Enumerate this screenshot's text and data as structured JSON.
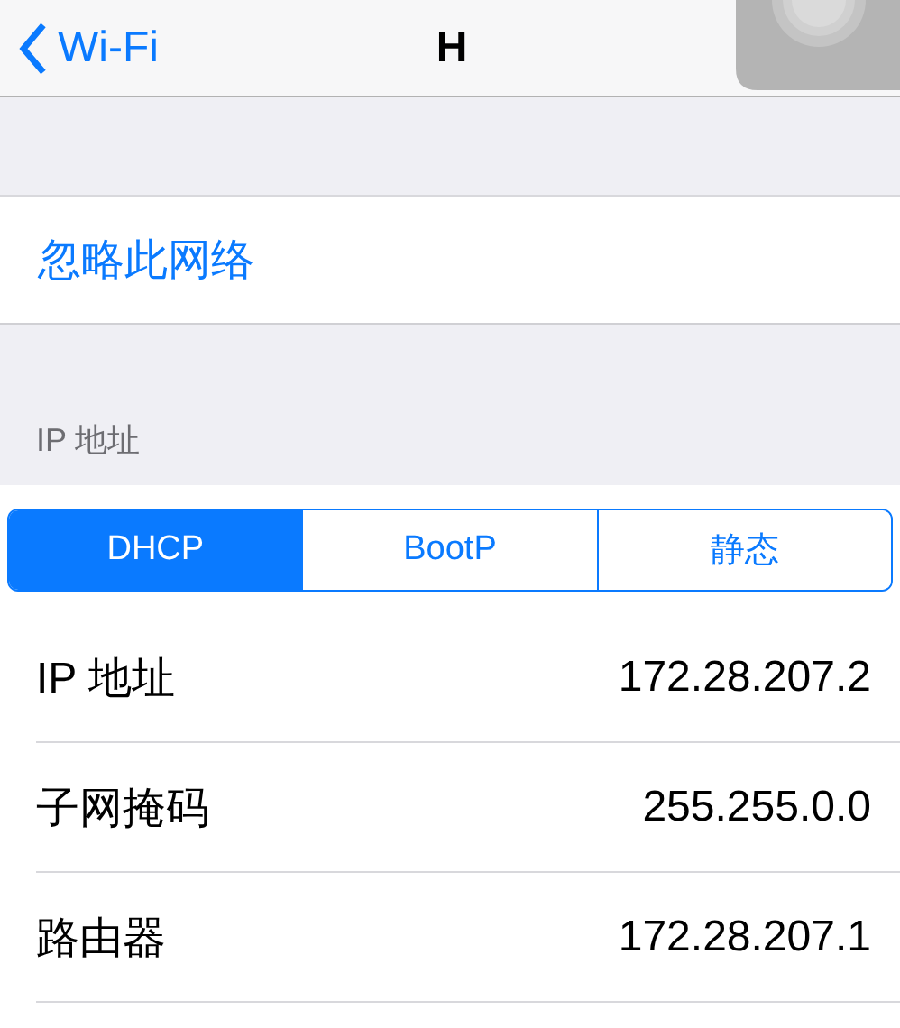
{
  "nav_bar": {
    "back_label": "Wi-Fi",
    "title": "H"
  },
  "forget_network": {
    "label": "忽略此网络"
  },
  "ip_section": {
    "header": "IP 地址",
    "segments": [
      {
        "label": "DHCP",
        "selected": true
      },
      {
        "label": "BootP",
        "selected": false
      },
      {
        "label": "静态",
        "selected": false
      }
    ],
    "rows": [
      {
        "label": "IP 地址",
        "value": "172.28.207.2"
      },
      {
        "label": "子网掩码",
        "value": "255.255.0.0"
      },
      {
        "label": "路由器",
        "value": "172.28.207.1"
      }
    ]
  }
}
